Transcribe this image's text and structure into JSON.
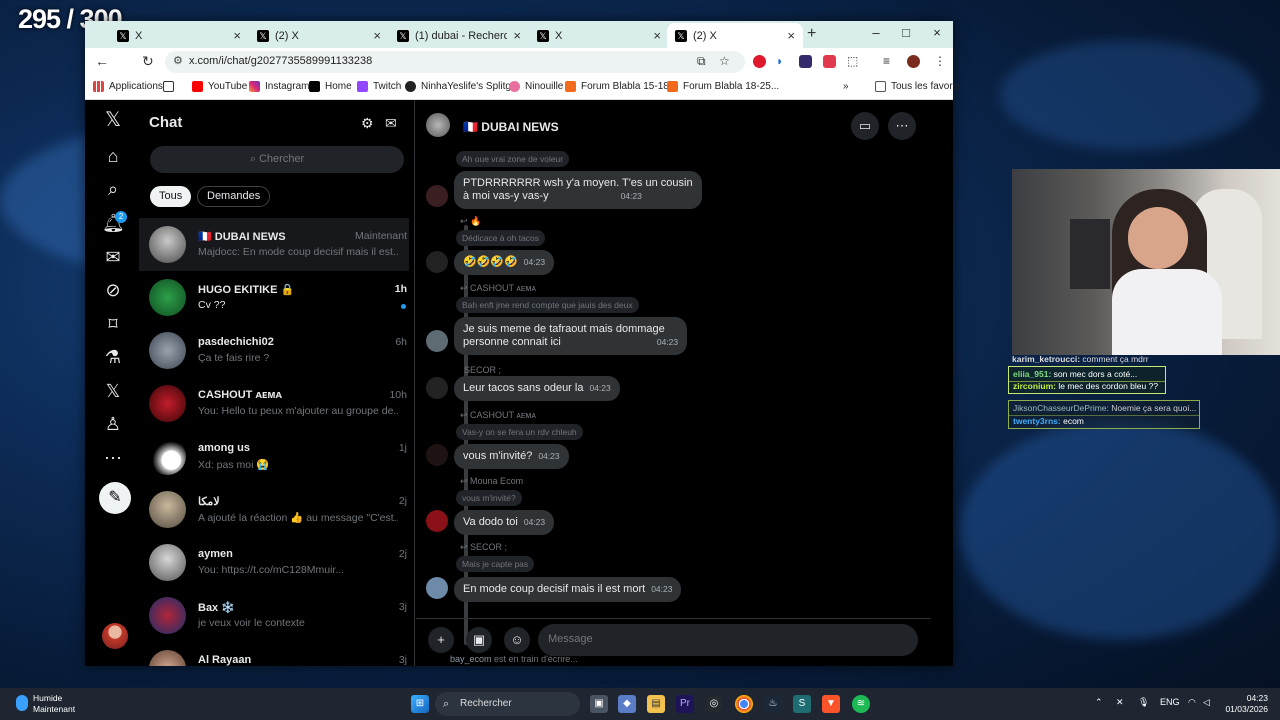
{
  "stream": {
    "counter": "295 / 300"
  },
  "browser": {
    "tabs": [
      {
        "title": "X"
      },
      {
        "title": "(2) X"
      },
      {
        "title": "(1) dubai - Recherche / X"
      },
      {
        "title": "X"
      },
      {
        "title": "(2) X"
      }
    ],
    "url": "x.com/i/chat/g2027735589991133238",
    "bookmarks": [
      "Applications",
      "YouTube",
      "Instagram",
      "Home",
      "Twitch",
      "NinhaYeslife's Splitg...",
      "Ninouille",
      "Forum Blabla 15-18...",
      "Forum Blabla 18-25..."
    ],
    "all_bookmarks": "Tous les favoris"
  },
  "x": {
    "chat_title": "Chat",
    "search_placeholder": "Chercher",
    "filters": {
      "all": "Tous",
      "requests": "Demandes"
    },
    "notif_badge": "2",
    "conversations": [
      {
        "name": "🇫🇷 DUBAI NEWS",
        "time": "Maintenant",
        "preview": "Majdocc: En mode coup decisif mais il est..."
      },
      {
        "name": "HUGO EKITIKE 🔒",
        "time": "1h",
        "preview": "Cv ??"
      },
      {
        "name": "pasdechichi02",
        "time": "6h",
        "preview": "Ça te fais rire ?"
      },
      {
        "name": "CASHOUT ᴀᴇᴍᴀ",
        "time": "10h",
        "preview": "You: Hello tu peux m'ajouter au groupe de..."
      },
      {
        "name": "among us",
        "time": "1j",
        "preview": "Xd: pas moi 😭"
      },
      {
        "name": "لامكا",
        "time": "2j",
        "preview": "A ajouté la réaction 👍 au message \"C'est..."
      },
      {
        "name": "aymen",
        "time": "2j",
        "preview": "You: https://t.co/mC128Mmuir..."
      },
      {
        "name": "Bax ❄️",
        "time": "3j",
        "preview": "je veux voir le contexte"
      },
      {
        "name": "Al Rayaan",
        "time": "3j",
        "preview": ""
      }
    ],
    "conversation": {
      "name": "🇫🇷 DUBAI NEWS",
      "messages": [
        {
          "quote": "Ah oue vrai zone de voleur",
          "text1": "PTDRRRRRRR wsh y'a moyen. T'es un cousin",
          "text2": "à moi vas-y vas-y",
          "time": "04:23"
        },
        {
          "reply": "↩ 🔥",
          "quote": "Dédicace à oh tacos",
          "text1": "🤣🤣🤣🤣",
          "time": "04:23"
        },
        {
          "reply": "↩ CASHOUT ᴀᴇᴍᴀ",
          "quote": "Bah enft jme rend compte que jauis des deux",
          "text1": "Je suis meme de tafraout mais dommage",
          "text2": "personne connait ici",
          "time": "04:23"
        },
        {
          "reply": "SECOR ;",
          "text1": "Leur tacos sans odeur la",
          "time": "04:23"
        },
        {
          "reply": "↩ CASHOUT ᴀᴇᴍᴀ",
          "quote": "Vas-y on se fera un rdv chleuh",
          "text1": "vous m'invité?",
          "time": "04:23"
        },
        {
          "reply": "↩ Mouna Ecom",
          "quote": "vous m'invité?",
          "text1": "Va dodo toi",
          "time": "04:23"
        },
        {
          "reply": "↩ SECOR ;",
          "quote": "Mais je capte pas",
          "text1": "En mode coup decisif mais il est mort",
          "time": "04:23"
        }
      ],
      "typing_user": "bay_ecom",
      "typing_text": "est en train d'écrire...",
      "input_placeholder": "Message"
    }
  },
  "stream_chat": [
    {
      "user": "karim_ketroucci:",
      "text": "comment ça mdrr"
    },
    {
      "user": "eliia_951:",
      "text": "son mec dors a coté..."
    },
    {
      "user": "zirconium:",
      "text": "le mec des cordon bleu ??"
    },
    {
      "user": "JiksonChasseurDePrime:",
      "text": "Noemie ça sera quoi..."
    },
    {
      "user": "twenty3rns:",
      "text": "ecom"
    }
  ],
  "taskbar": {
    "weather": "Humide",
    "weather_sub": "Maintenant",
    "search": "Rechercher",
    "lang": "ENG",
    "time": "04:23",
    "date": "01/03/2026"
  }
}
